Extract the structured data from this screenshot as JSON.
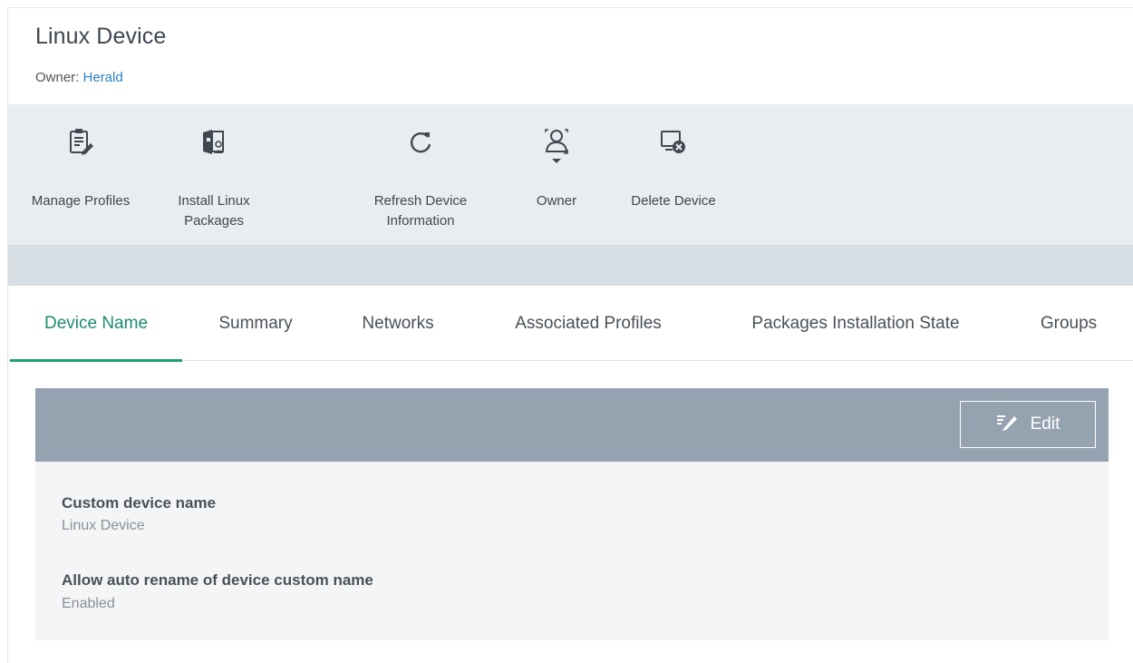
{
  "header": {
    "title": "Linux Device",
    "owner_prefix": "Owner: ",
    "owner_name": "Herald"
  },
  "toolbar": {
    "items": [
      {
        "id": "manage-profiles",
        "icon": "clipboard-edit-icon",
        "label": "Manage Profiles"
      },
      {
        "id": "install-linux-packages",
        "icon": "package-install-icon",
        "label": "Install Linux\nPackages"
      },
      {
        "id": "refresh-device-information",
        "icon": "refresh-icon",
        "label": "Refresh Device\nInformation"
      },
      {
        "id": "owner",
        "icon": "user-dropdown-icon",
        "label": "Owner"
      },
      {
        "id": "delete-device",
        "icon": "device-delete-icon",
        "label": "Delete Device"
      }
    ]
  },
  "tabs": [
    {
      "label": "Device Name",
      "active": true
    },
    {
      "label": "Summary",
      "active": false
    },
    {
      "label": "Networks",
      "active": false
    },
    {
      "label": "Associated Profiles",
      "active": false
    },
    {
      "label": "Packages Installation State",
      "active": false
    },
    {
      "label": "Groups",
      "active": false
    }
  ],
  "panel": {
    "edit_label": "Edit",
    "fields": [
      {
        "label": "Custom device name",
        "value": "Linux Device"
      },
      {
        "label": "Allow auto rename of device custom name",
        "value": "Enabled"
      }
    ]
  },
  "colors": {
    "accent": "#1e9e7b",
    "link": "#2e7fc2",
    "toolbar_bg": "#e9edf0",
    "panel_header": "#95a3b0"
  }
}
